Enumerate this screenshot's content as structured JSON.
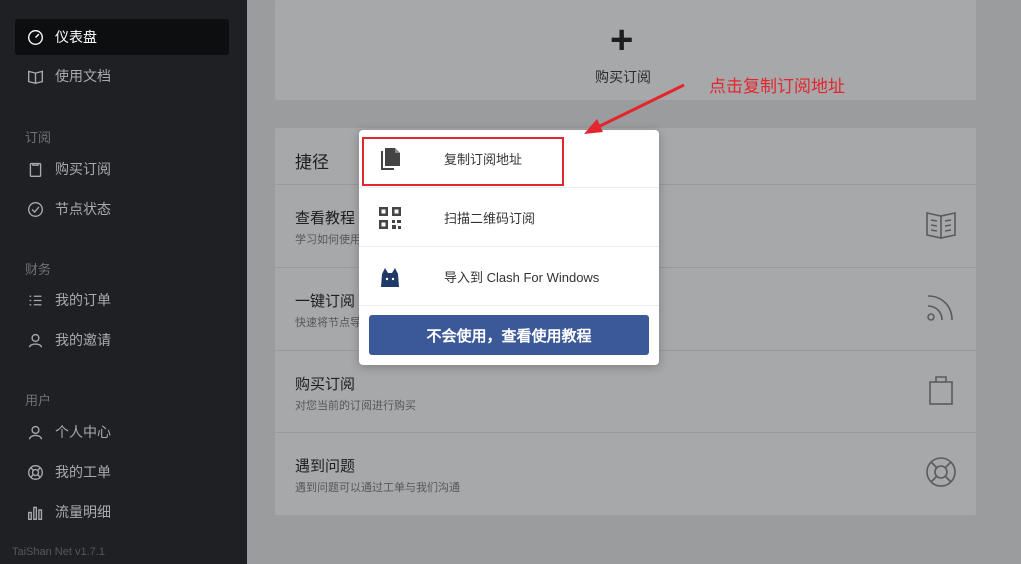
{
  "sidebar": {
    "items": [
      {
        "label": "仪表盘",
        "icon": "dashboard-icon",
        "active": true
      },
      {
        "label": "使用文档",
        "icon": "book-icon"
      },
      {
        "label": "购买订阅",
        "icon": "clipboard-icon"
      },
      {
        "label": "节点状态",
        "icon": "check-circle-icon"
      },
      {
        "label": "我的订单",
        "icon": "list-icon"
      },
      {
        "label": "我的邀请",
        "icon": "users-icon"
      },
      {
        "label": "个人中心",
        "icon": "user-icon"
      },
      {
        "label": "我的工单",
        "icon": "lifebuoy-icon"
      },
      {
        "label": "流量明细",
        "icon": "bar-chart-icon"
      }
    ],
    "sections": {
      "subscribe": "订阅",
      "finance": "财务",
      "user": "用户"
    },
    "version": "TaiShan Net v1.7.1"
  },
  "main": {
    "buy_label": "购买订阅",
    "shortcuts_title": "捷径",
    "rows": [
      {
        "title": "查看教程",
        "desc": "学习如何使用",
        "icon": "book-icon"
      },
      {
        "title": "一键订阅",
        "desc": "快速将节点导",
        "icon": "rss-icon"
      },
      {
        "title": "购买订阅",
        "desc": "对您当前的订阅进行购买",
        "icon": "bag-icon"
      },
      {
        "title": "遇到问题",
        "desc": "遇到问题可以通过工单与我们沟通",
        "icon": "lifebuoy-icon"
      }
    ]
  },
  "popup": {
    "items": [
      {
        "label": "复制订阅地址",
        "icon": "copy-icon"
      },
      {
        "label": "扫描二维码订阅",
        "icon": "qrcode-icon"
      },
      {
        "label": "导入到 Clash For Windows",
        "icon": "clash-cat-icon"
      }
    ],
    "button": "不会使用，查看使用教程"
  },
  "annotation": {
    "text": "点击复制订阅地址",
    "color": "#e3262d"
  },
  "colors": {
    "accent": "#3b5998",
    "sidebar_bg": "#1e2023"
  }
}
